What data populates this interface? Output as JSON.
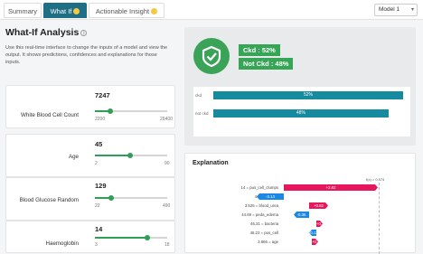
{
  "tabs": [
    {
      "label": "Summary"
    },
    {
      "label": "What If"
    },
    {
      "label": "Actionable Insight"
    }
  ],
  "model_select": {
    "value": "Model 1"
  },
  "whatif": {
    "title": "What-If Analysis",
    "description": "Use this real-time interface to change the inputs of a model and view the output. It shows predictions, confidences and explanations for those inputs.",
    "features": [
      {
        "name": "White Blood Cell Count",
        "value": "7247",
        "min": "2200",
        "max": "26400",
        "fraction": 0.21
      },
      {
        "name": "Age",
        "value": "45",
        "min": "2",
        "max": "90",
        "fraction": 0.49
      },
      {
        "name": "Blood Glucose Random",
        "value": "129",
        "min": "22",
        "max": "490",
        "fraction": 0.23
      },
      {
        "name": "Haemoglobin",
        "value": "14",
        "min": "3",
        "max": "18",
        "fraction": 0.73
      }
    ]
  },
  "prediction": {
    "classes": [
      {
        "label": "Ckd : 52%"
      },
      {
        "label": "Not Ckd : 48%"
      }
    ],
    "bars": [
      {
        "label": "ckd",
        "value": "52%",
        "fraction": 0.52
      },
      {
        "label": "not ckd",
        "value": "48%",
        "fraction": 0.48
      }
    ]
  },
  "explanation": {
    "title": "Explanation",
    "fx_label": "f(x) = 0.574",
    "rows": [
      {
        "label": "14 = pus_cell_clumps",
        "value": "+2.82",
        "sign": "pos"
      },
      {
        "label": "44.45 = sugar",
        "value": "-3.14",
        "sign": "neg"
      },
      {
        "label": "3.525 = blood_urea",
        "value": "+0.82",
        "sign": "pos"
      },
      {
        "label": "44.69 = peda_edema",
        "value": "-0.36",
        "sign": "neg"
      },
      {
        "label": "46.31 = bacteria",
        "value": "+0.15",
        "sign": "pos"
      },
      {
        "label": "46.23 = pus_cell",
        "value": "-0.12",
        "sign": "neg"
      },
      {
        "label": "3.866 = age",
        "value": "+0.1",
        "sign": "pos"
      }
    ]
  }
}
